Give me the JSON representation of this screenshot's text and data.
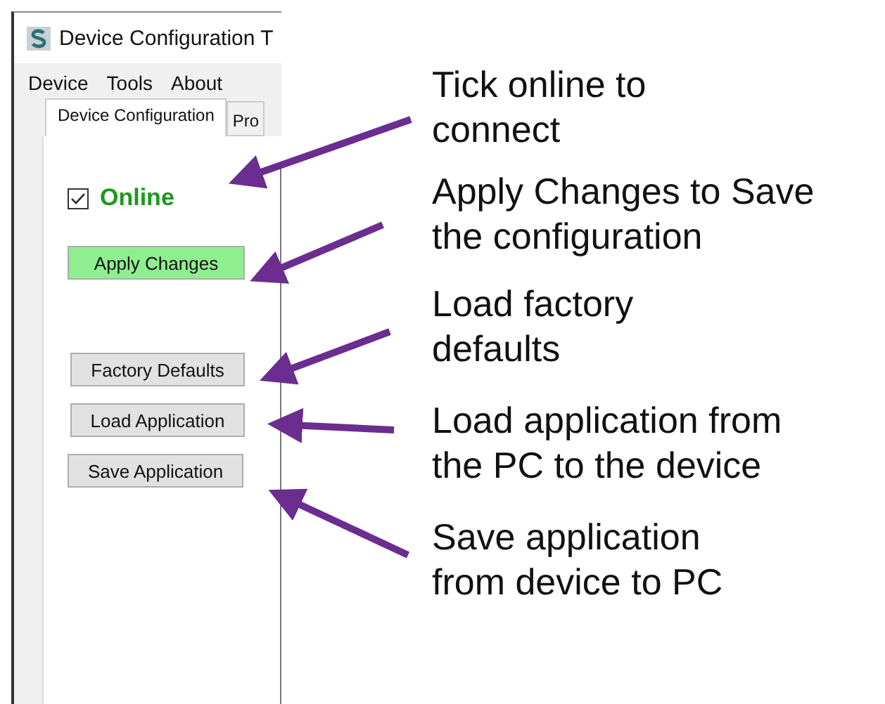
{
  "window": {
    "title": "Device Configuration T"
  },
  "menu": [
    "Device",
    "Tools",
    "About"
  ],
  "tabs": [
    {
      "label": "Device Configuration",
      "selected": true
    },
    {
      "label": "Pro",
      "selected": false
    }
  ],
  "online": {
    "label": "Online",
    "checked": true
  },
  "buttons": [
    {
      "label": "Apply Changes",
      "kind": "highlight"
    },
    {
      "label": "Factory Defaults",
      "kind": "normal"
    },
    {
      "label": "Load Application",
      "kind": "normal"
    },
    {
      "label": "Save Application",
      "kind": "normal"
    }
  ],
  "annotations": [
    {
      "lines": [
        "Tick online to",
        "connect"
      ]
    },
    {
      "lines": [
        "Apply Changes to Save",
        "the configuration"
      ]
    },
    {
      "lines": [
        "Load factory",
        "defaults"
      ]
    },
    {
      "lines": [
        "Load application from",
        "the PC to the device"
      ]
    },
    {
      "lines": [
        "Save application",
        "from device to PC"
      ]
    }
  ]
}
